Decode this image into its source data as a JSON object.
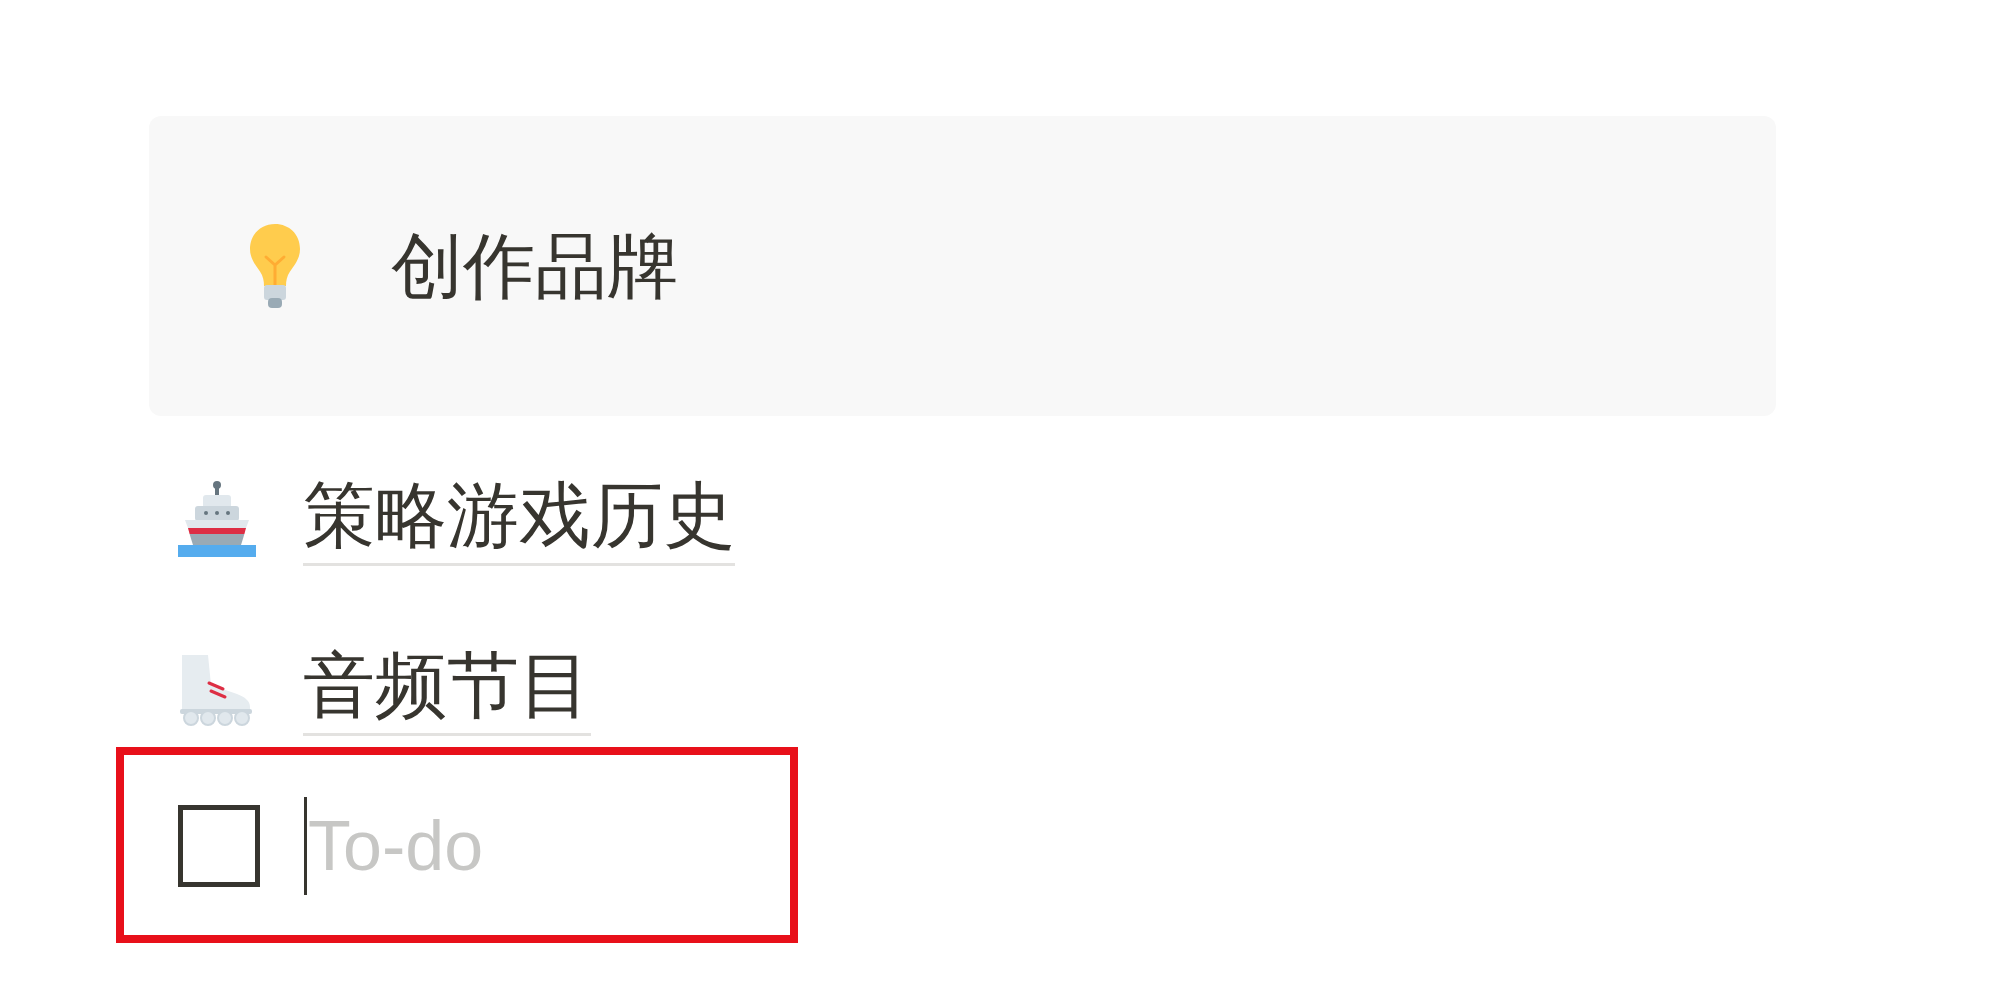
{
  "callout": {
    "text": "创作品牌"
  },
  "page_links": [
    {
      "title": "策略游戏历史"
    },
    {
      "title": "音频节目"
    }
  ],
  "todo": {
    "placeholder": "To-do",
    "checked": false,
    "focused": true,
    "highlighted": true
  }
}
